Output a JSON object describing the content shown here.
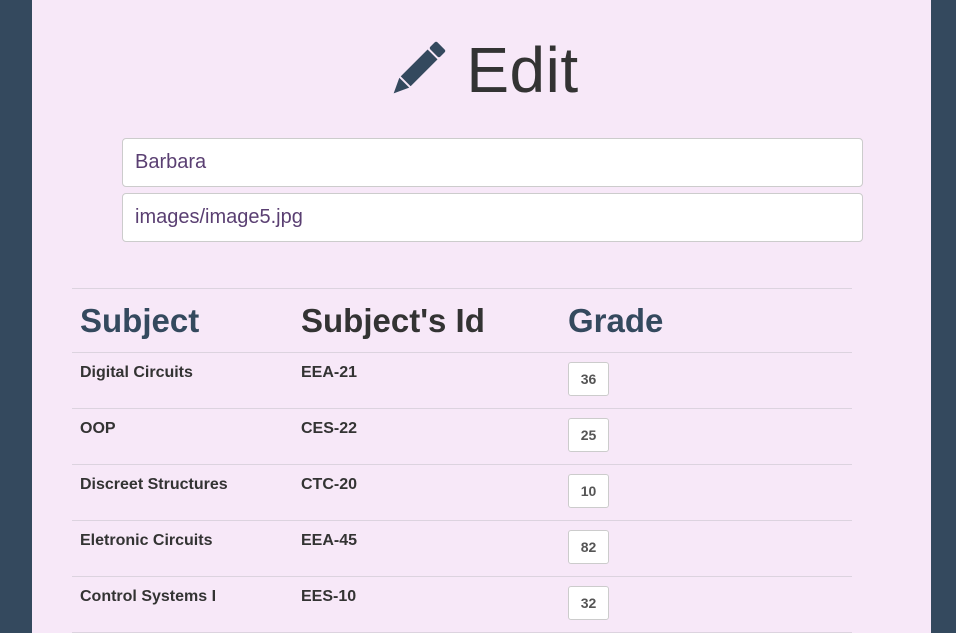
{
  "header": {
    "icon": "pencil-icon",
    "title": "Edit"
  },
  "form": {
    "name_value": "Barbara",
    "image_value": "images/image5.jpg"
  },
  "table": {
    "headers": [
      "Subject",
      "Subject's Id",
      "Grade"
    ],
    "rows": [
      {
        "subject": "Digital Circuits",
        "id": "EEA-21",
        "grade": "36"
      },
      {
        "subject": "OOP",
        "id": "CES-22",
        "grade": "25"
      },
      {
        "subject": "Discreet Structures",
        "id": "CTC-20",
        "grade": "10"
      },
      {
        "subject": "Eletronic Circuits",
        "id": "EEA-45",
        "grade": "82"
      },
      {
        "subject": "Control Systems I",
        "id": "EES-10",
        "grade": "32"
      }
    ]
  },
  "colors": {
    "page_background": "#34495e",
    "panel_background": "#f7e8f8",
    "heading_accent": "#34495e",
    "text": "#333333"
  }
}
